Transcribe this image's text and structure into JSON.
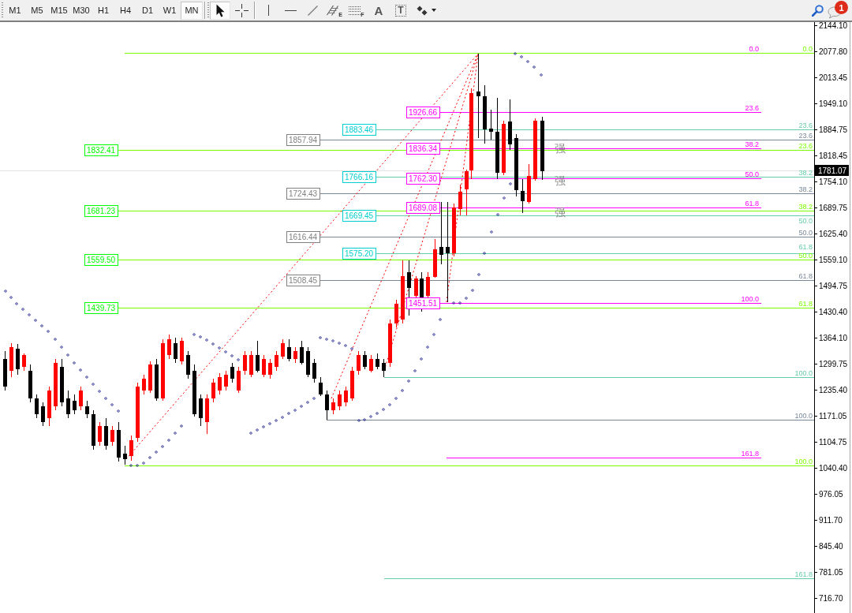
{
  "toolbar": {
    "timeframes": [
      {
        "label": "M1",
        "selected": false
      },
      {
        "label": "M5",
        "selected": false
      },
      {
        "label": "M15",
        "selected": false
      },
      {
        "label": "M30",
        "selected": false
      },
      {
        "label": "H1",
        "selected": false
      },
      {
        "label": "H4",
        "selected": false
      },
      {
        "label": "D1",
        "selected": false
      },
      {
        "label": "W1",
        "selected": false
      },
      {
        "label": "MN",
        "selected": true
      }
    ],
    "tools": [
      {
        "kind": "cursor",
        "selected": true
      },
      {
        "kind": "crosshair",
        "selected": false
      },
      {
        "kind": "vertical-line",
        "selected": false
      },
      {
        "kind": "horizontal-line",
        "selected": false
      },
      {
        "kind": "trend-line",
        "selected": false
      },
      {
        "kind": "channel",
        "glyph": "E",
        "selected": false
      },
      {
        "kind": "fibonacci",
        "glyph": "F",
        "selected": false
      },
      {
        "kind": "text",
        "glyph": "A",
        "selected": false
      },
      {
        "kind": "text-label",
        "glyph": "T",
        "selected": false
      },
      {
        "kind": "shapes",
        "selected": false
      }
    ],
    "notifications": {
      "badge": "1"
    }
  },
  "chart": {
    "fibonacci": [
      {
        "color": "#ff00ff",
        "levels": [
          {
            "label": "0.0"
          },
          {
            "label": "23.6",
            "price_label": {
              "text": "1926.66",
              "color": "#ff00ff"
            }
          },
          {
            "label": "38.2",
            "price_label": {
              "text": "1836.34",
              "color": "#ff00ff"
            }
          },
          {
            "label": "50.0",
            "price_label": {
              "text": "1762.30",
              "color": "#ff00ff"
            }
          },
          {
            "label": "61.8",
            "price_label": {
              "text": "1689.08",
              "color": "#ff00ff"
            }
          },
          {
            "label": "100.0",
            "price_label": {
              "text": "1451.51",
              "color": "#ff00ff"
            }
          },
          {
            "label": "161.8"
          }
        ]
      },
      {
        "color": "#66cdaa",
        "levels": [
          {
            "label": "23.6",
            "price_label": {
              "text": "1883.46",
              "color": "#00ced1"
            }
          },
          {
            "label": "38.2",
            "price_label": {
              "text": "1766.16",
              "color": "#00ced1"
            }
          },
          {
            "label": "50.0",
            "price_label": {
              "text": "1669.45",
              "color": "#00ced1"
            }
          },
          {
            "label": "61.8",
            "price_label": {
              "text": "1575.20",
              "color": "#00ced1"
            }
          },
          {
            "label": "100.0"
          },
          {
            "label": "161.8"
          }
        ]
      },
      {
        "color": "#778899",
        "levels": [
          {
            "label": "23.6",
            "price_label": {
              "text": "1857.94",
              "color": "#808080"
            }
          },
          {
            "label": "38.2",
            "price_label": {
              "text": "1724.43",
              "color": "#808080"
            }
          },
          {
            "label": "50.0",
            "price_label": {
              "text": "1616.44",
              "color": "#808080"
            }
          },
          {
            "label": "61.8",
            "price_label": {
              "text": "1508.45",
              "color": "#808080"
            }
          },
          {
            "label": "100.0"
          }
        ]
      },
      {
        "color": "#7cfc00",
        "levels": [
          {
            "label": "0.0"
          },
          {
            "label": "23.6",
            "price_label": {
              "text": "1832.41",
              "color": "#00ff00"
            }
          },
          {
            "label": "38.2",
            "price_label": {
              "text": "1681.23",
              "color": "#00ff00"
            }
          },
          {
            "label": "50.0",
            "price_label": {
              "text": "1559.50",
              "color": "#00ff00"
            }
          },
          {
            "label": "61.8",
            "price_label": {
              "text": "1439.73",
              "color": "#00ff00"
            }
          },
          {
            "label": "100.0"
          }
        ]
      }
    ],
    "text_marks": [
      "强",
      "强",
      "强"
    ],
    "price_axis": {
      "ticks": [
        "2144.10",
        "2077.80",
        "2013.45",
        "1949.10",
        "1884.75",
        "1818.45",
        "1754.10",
        "1689.75",
        "1625.40",
        "1559.10",
        "1494.75",
        "1430.40",
        "1364.10",
        "1299.75",
        "1235.40",
        "1171.05",
        "1104.75",
        "1040.40",
        "976.05",
        "911.70",
        "845.40",
        "781.05",
        "716.70"
      ],
      "current_price": "1781.07"
    }
  }
}
